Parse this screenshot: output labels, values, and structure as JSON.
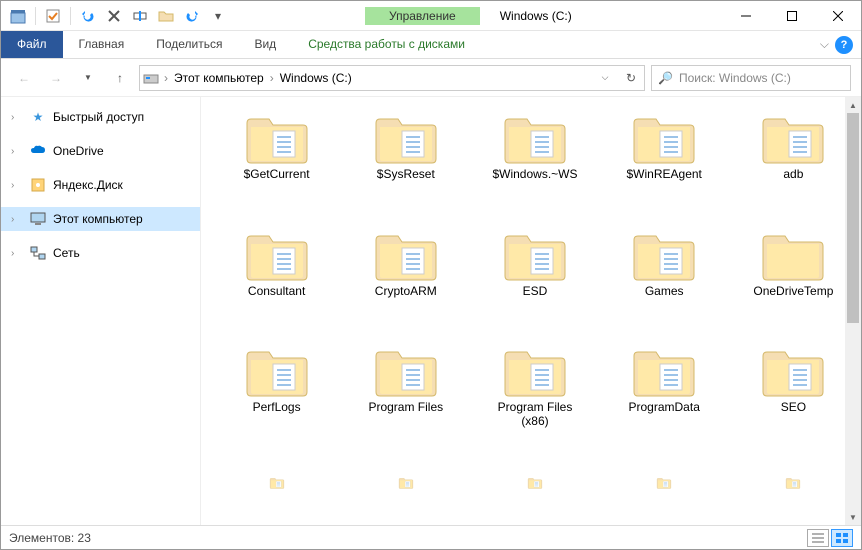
{
  "titlebar": {
    "contextual_tab": "Управление",
    "window_title": "Windows (C:)"
  },
  "ribbon": {
    "file": "Файл",
    "home": "Главная",
    "share": "Поделиться",
    "view": "Вид",
    "drive_tools": "Средства работы с дисками"
  },
  "nav": {
    "breadcrumb": [
      "Этот компьютер",
      "Windows (C:)"
    ],
    "search_placeholder": "Поиск: Windows (C:)"
  },
  "sidebar": {
    "items": [
      {
        "label": "Быстрый доступ",
        "icon": "star"
      },
      {
        "label": "OneDrive",
        "icon": "cloud"
      },
      {
        "label": "Яндекс.Диск",
        "icon": "disk"
      },
      {
        "label": "Этот компьютер",
        "icon": "monitor",
        "selected": true
      },
      {
        "label": "Сеть",
        "icon": "network"
      }
    ]
  },
  "folders": [
    "$GetCurrent",
    "$SysReset",
    "$Windows.~WS",
    "$WinREAgent",
    "adb",
    "Consultant",
    "CryptoARM",
    "ESD",
    "Games",
    "OneDriveTemp",
    "PerfLogs",
    "Program Files",
    "Program Files (x86)",
    "ProgramData",
    "SEO"
  ],
  "status": {
    "label": "Элементов:",
    "count": "23"
  }
}
